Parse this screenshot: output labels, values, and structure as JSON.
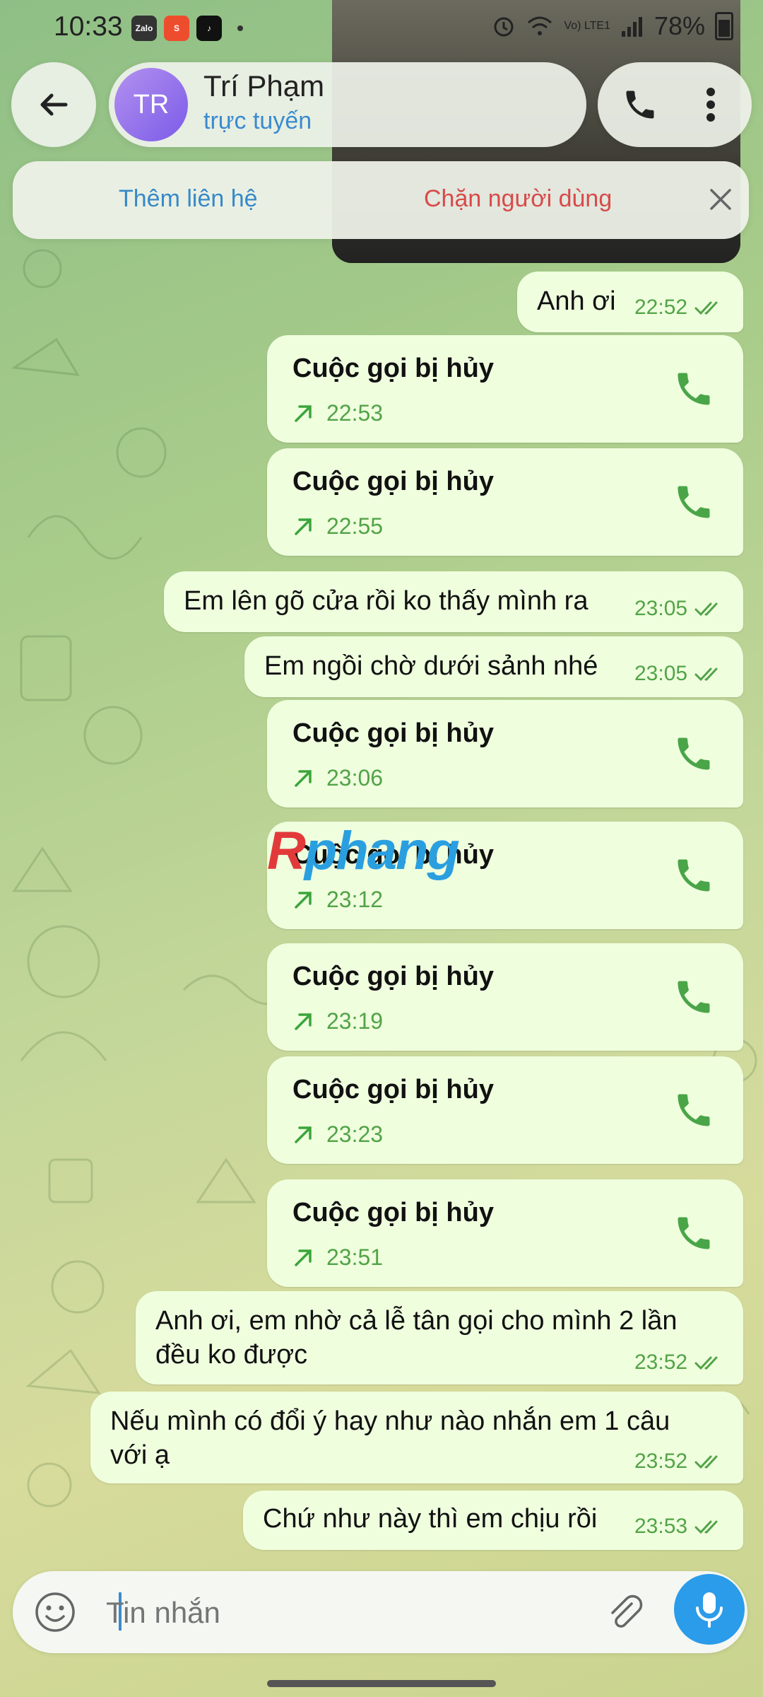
{
  "status_bar": {
    "time": "10:33",
    "apps": [
      "Zalo",
      "ShopeePay",
      "TikTok"
    ],
    "network_label": "Vo) LTE1",
    "battery": "78%"
  },
  "header": {
    "avatar_initials": "TR",
    "contact_name": "Trí Phạm",
    "contact_status": "trực tuyến"
  },
  "banner": {
    "add_contact": "Thêm liên hệ",
    "block_user": "Chặn người dùng"
  },
  "messages": [
    {
      "text": "Anh ơi",
      "time": "22:52"
    },
    {
      "call_title": "Cuộc gọi bị hủy",
      "time": "22:53"
    },
    {
      "call_title": "Cuộc gọi bị hủy",
      "time": "22:55"
    },
    {
      "text": "Em lên gõ cửa rồi ko thấy mình ra",
      "time": "23:05"
    },
    {
      "text": "Em ngồi chờ dưới sảnh nhé",
      "time": "23:05"
    },
    {
      "call_title": "Cuộc gọi bị hủy",
      "time": "23:06"
    },
    {
      "call_title": "Cuộc gọi bị hủy",
      "time": "23:12"
    },
    {
      "call_title": "Cuộc gọi bị hủy",
      "time": "23:19"
    },
    {
      "call_title": "Cuộc gọi bị hủy",
      "time": "23:23"
    },
    {
      "call_title": "Cuộc gọi bị hủy",
      "time": "23:51"
    },
    {
      "text_line1": "Anh ơi, em nhờ cả lễ tân gọi cho mình 2 lần",
      "text_line2": "đều ko được",
      "time": "23:52"
    },
    {
      "text_line1": "Nếu mình có đổi ý hay như nào nhắn em 1 câu",
      "text_line2": "với ạ",
      "time": "23:52"
    },
    {
      "text": "Chứ như này thì em chịu rồi",
      "time": "23:53"
    }
  ],
  "watermark": {
    "part1": "R",
    "part2": "phang"
  },
  "composer": {
    "placeholder": "Tin nhắn"
  },
  "colors": {
    "bubble": "#efffde",
    "accent": "#2a9cea",
    "time_green": "#52a347",
    "block_red": "#d84a4a"
  }
}
